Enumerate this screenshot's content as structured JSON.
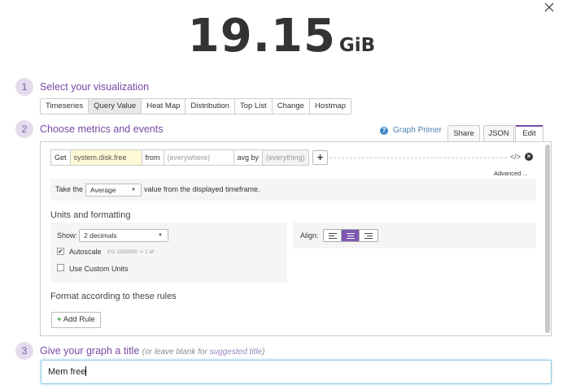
{
  "close_icon": "×",
  "value": {
    "number": "19.15",
    "unit": "GiB"
  },
  "steps": [
    {
      "num": "1",
      "title": "Select your visualization"
    },
    {
      "num": "2",
      "title": "Choose metrics and events"
    },
    {
      "num": "3",
      "title": "Give your graph a title",
      "sub_pre": "(or leave blank for ",
      "sub_link": "suggested title",
      "sub_post": ")"
    }
  ],
  "viz_types": [
    "Timeseries",
    "Query Value",
    "Heat Map",
    "Distribution",
    "Top List",
    "Change",
    "Hostmap"
  ],
  "active_viz": "Query Value",
  "graph_primer": "Graph Primer",
  "tabs": [
    "Share",
    "JSON",
    "Edit"
  ],
  "active_tab": "Edit",
  "query": {
    "get_label": "Get",
    "metric": "system.disk.free",
    "from_label": "from",
    "from_value": "(everywhere)",
    "agg_label": "avg by",
    "agg_value": "(everything)",
    "add": "+",
    "code_icon": "</>",
    "remove_icon": "×",
    "advanced": "Advanced ..."
  },
  "take": {
    "pre": "Take the",
    "value": "Average",
    "post": "value from the displayed timeframe."
  },
  "units": {
    "title": "Units and formatting",
    "show_label": "Show:",
    "show_value": "2 decimals",
    "autoscale_label": "Autoscale",
    "autoscale_checked": true,
    "autoscale_hint": "EG 1000000 -> 1 M",
    "custom_units_label": "Use Custom Units",
    "custom_units_checked": false,
    "align_label": "Align:",
    "align_options": [
      "left",
      "center",
      "right"
    ],
    "align_selected": "center"
  },
  "format": {
    "title": "Format according to these rules",
    "add_rule_plus": "+",
    "add_rule": "Add Rule"
  },
  "title_input": {
    "value": "Mem free"
  },
  "colors": {
    "accent": "#774aa4",
    "active_align": "#7e58b0",
    "metric_bg": "#fff9d6"
  }
}
